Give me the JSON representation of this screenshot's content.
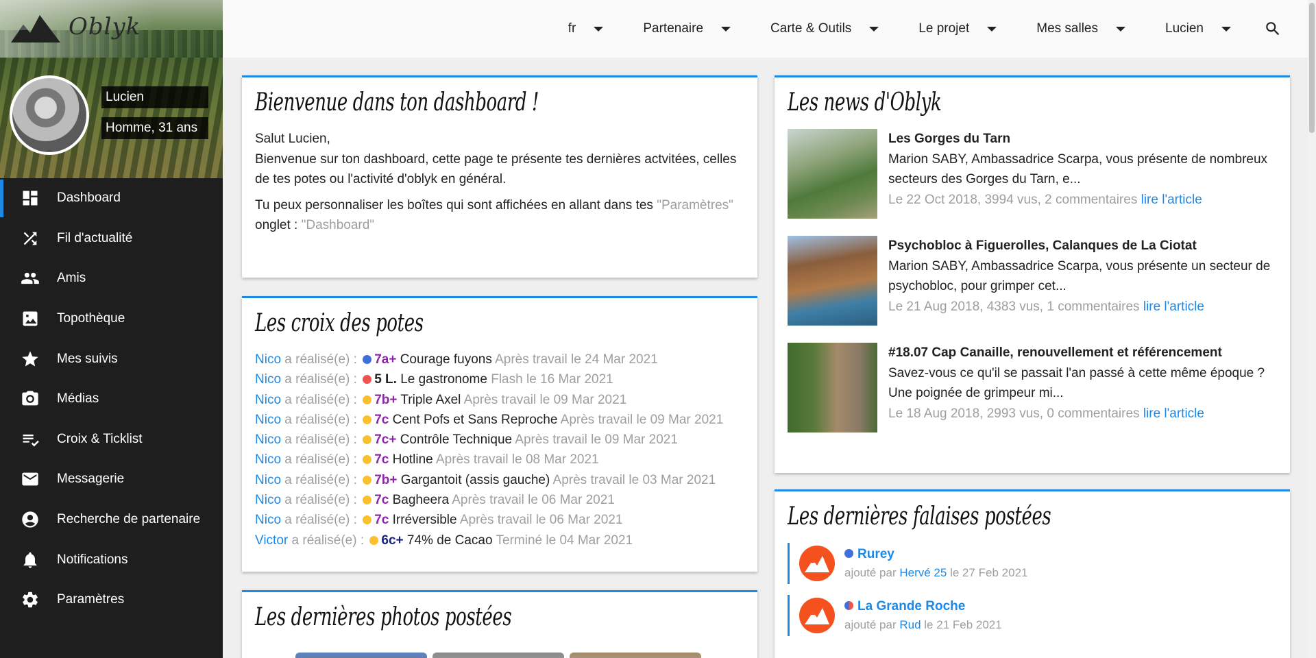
{
  "app": {
    "logo_text": "Oblyk"
  },
  "profile": {
    "name": "Lucien",
    "info": "Homme, 31 ans"
  },
  "sidebar": {
    "items": [
      {
        "label": "Dashboard",
        "icon": "dashboard-icon"
      },
      {
        "label": "Fil d'actualité",
        "icon": "shuffle-icon"
      },
      {
        "label": "Amis",
        "icon": "people-icon"
      },
      {
        "label": "Topothèque",
        "icon": "image-icon"
      },
      {
        "label": "Mes suivis",
        "icon": "star-icon"
      },
      {
        "label": "Médias",
        "icon": "camera-icon"
      },
      {
        "label": "Croix & Ticklist",
        "icon": "checklist-icon"
      },
      {
        "label": "Messagerie",
        "icon": "mail-icon"
      },
      {
        "label": "Recherche de partenaire",
        "icon": "account-circle-icon"
      },
      {
        "label": "Notifications",
        "icon": "bell-icon"
      },
      {
        "label": "Paramètres",
        "icon": "gear-icon"
      }
    ]
  },
  "topbar": {
    "menu": [
      "fr",
      "Partenaire",
      "Carte & Outils",
      "Le projet",
      "Mes salles",
      "Lucien"
    ]
  },
  "welcome": {
    "title": "Bienvenue dans ton dashboard !",
    "greeting": "Salut Lucien,",
    "intro": "Bienvenue sur ton dashboard, cette page te présente tes dernières actvitées, celles de tes potes ou l'activité d'oblyk en général.",
    "custom_prefix": "Tu peux personnaliser les boîtes qui sont affichées en allant dans tes",
    "custom_params": "\"Paramètres\"",
    "custom_mid": "onglet :",
    "custom_tab": "\"Dashboard\""
  },
  "croix": {
    "title": "Les croix des potes",
    "action": "a réalisé(e) :",
    "items": [
      {
        "user": "Nico",
        "grade": "7a+",
        "route": "Courage fuyons",
        "detail": "Après travail le 24 Mar 2021",
        "dot": "#3f6fd8",
        "grade_color": "#8e24aa"
      },
      {
        "user": "Nico",
        "grade": "5 L.",
        "route": "Le gastronome",
        "detail": "Flash le 16 Mar 2021",
        "dot": "#ef5350",
        "grade_color": "#222222"
      },
      {
        "user": "Nico",
        "grade": "7b+",
        "route": "Triple Axel",
        "detail": "Après travail le 09 Mar 2021",
        "dot": "#fbc02d",
        "grade_color": "#8e24aa"
      },
      {
        "user": "Nico",
        "grade": "7c",
        "route": "Cent Pofs et Sans Reproche",
        "detail": "Après travail le 09 Mar 2021",
        "dot": "#fbc02d",
        "grade_color": "#8e24aa"
      },
      {
        "user": "Nico",
        "grade": "7c+",
        "route": "Contrôle Technique",
        "detail": "Après travail le 09 Mar 2021",
        "dot": "#fbc02d",
        "grade_color": "#8e24aa"
      },
      {
        "user": "Nico",
        "grade": "7c",
        "route": "Hotline",
        "detail": "Après travail le 08 Mar 2021",
        "dot": "#fbc02d",
        "grade_color": "#8e24aa"
      },
      {
        "user": "Nico",
        "grade": "7b+",
        "route": "Gargantoit (assis gauche)",
        "detail": "Après travail le 03 Mar 2021",
        "dot": "#fbc02d",
        "grade_color": "#8e24aa"
      },
      {
        "user": "Nico",
        "grade": "7c",
        "route": "Bagheera",
        "detail": "Après travail le 06 Mar 2021",
        "dot": "#fbc02d",
        "grade_color": "#8e24aa"
      },
      {
        "user": "Nico",
        "grade": "7c",
        "route": "Irréversible",
        "detail": "Après travail le 06 Mar 2021",
        "dot": "#fbc02d",
        "grade_color": "#8e24aa"
      },
      {
        "user": "Victor",
        "grade": "6c+",
        "route": "74% de Cacao",
        "detail": "Terminé le 04 Mar 2021",
        "dot": "#fbc02d",
        "grade_color": "#1a237e"
      }
    ]
  },
  "photos": {
    "title": "Les dernières photos postées"
  },
  "news": {
    "title": "Les news d'Oblyk",
    "link_label": "lire l'article",
    "items": [
      {
        "title": "Les Gorges du Tarn",
        "summary": "Marion SABY, Ambassadrice Scarpa, vous présente de nombreux secteurs des Gorges du Tarn, e...",
        "meta": "Le 22 Oct 2018, 3994 vus, 2 commentaires"
      },
      {
        "title": "Psychobloc à Figuerolles, Calanques de La Ciotat",
        "summary": "Marion SABY, Ambassadrice Scarpa, vous présente un secteur de psychobloc, pour grimper cet...",
        "meta": "Le 21 Aug 2018, 4383 vus, 1 commentaires"
      },
      {
        "title": "#18.07 Cap Canaille, renouvellement et référencement",
        "summary": "Savez-vous ce qu'il se passait l'an passé à cette même époque ? Une poignée de grimpeur mi...",
        "meta": "Le 18 Aug 2018, 2993 vus, 0 commentaires"
      }
    ]
  },
  "falaises": {
    "title": "Les dernières falaises postées",
    "added_by": "ajouté par",
    "items": [
      {
        "name": "Rurey",
        "user": "Hervé 25",
        "date": "le 27 Feb 2021"
      },
      {
        "name": "La Grande Roche",
        "user": "Rud",
        "date": "le 21 Feb 2021"
      }
    ]
  },
  "colors": {
    "accent": "#1e88e5",
    "sidebar_bg": "#1e1e1e",
    "crag_icon": "#f4511e"
  }
}
